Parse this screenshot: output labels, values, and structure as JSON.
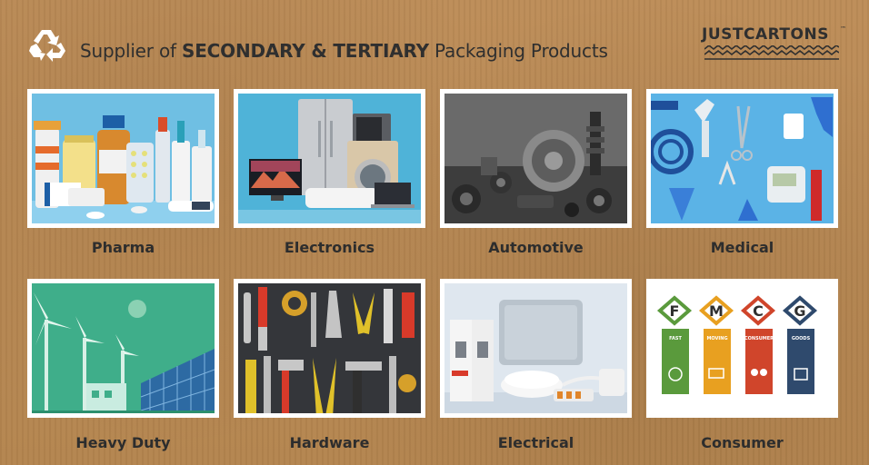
{
  "header": {
    "tagline_prefix": "Supplier of ",
    "tagline_bold": "SECONDARY & TERTIARY",
    "tagline_suffix": " Packaging Products",
    "brand_name": "JUSTCARTONS",
    "brand_tm": "™",
    "icon": "recycle-icon"
  },
  "categories": [
    {
      "label": "Pharma",
      "image": "pharma-products-image"
    },
    {
      "label": "Electronics",
      "image": "electronics-appliances-image"
    },
    {
      "label": "Automotive",
      "image": "automotive-parts-image"
    },
    {
      "label": "Medical",
      "image": "medical-instruments-image"
    },
    {
      "label": "Heavy Duty",
      "image": "wind-solar-energy-image"
    },
    {
      "label": "Hardware",
      "image": "hand-tools-image"
    },
    {
      "label": "Electrical",
      "image": "electrical-components-image"
    },
    {
      "label": "Consumer",
      "image": "fmcg-infographic-image"
    }
  ],
  "fmcg": {
    "letters": [
      "F",
      "M",
      "C",
      "G"
    ],
    "words": [
      "FAST",
      "MOVING",
      "CONSUMER",
      "GOODS"
    ],
    "colors": [
      "#5a9a3c",
      "#e8a020",
      "#d0452b",
      "#2f4a6d"
    ]
  },
  "colors": {
    "background": "#b98a55",
    "text": "#2d2d2d"
  }
}
